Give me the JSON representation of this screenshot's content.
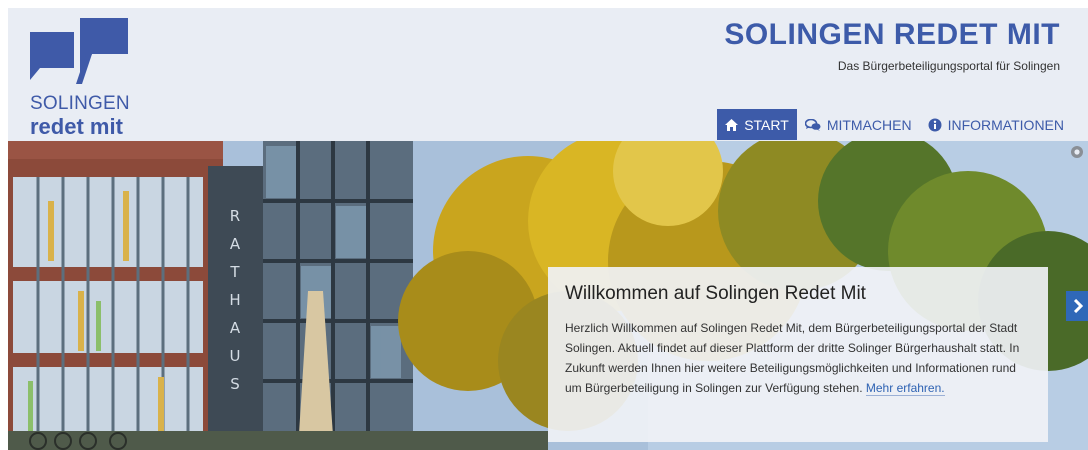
{
  "header": {
    "logo_line1": "SOLINGEN",
    "logo_line2": "redet mit",
    "title": "SOLINGEN REDET MIT",
    "subtitle": "Das Bürgerbeteiligungsportal für Solingen"
  },
  "nav": {
    "items": [
      {
        "label": "START",
        "icon": "home-icon",
        "active": true
      },
      {
        "label": "MITMACHEN",
        "icon": "chat-icon",
        "active": false
      },
      {
        "label": "INFORMATIONEN",
        "icon": "info-icon",
        "active": false
      }
    ]
  },
  "hero": {
    "building_sign": "RATHAUS",
    "welcome_title": "Willkommen auf Solingen Redet Mit",
    "welcome_text": "Herzlich Willkommen auf Solingen Redet Mit, dem Bürgerbeteiligungsportal der Stadt Solingen. Aktuell findet auf dieser Plattform der dritte Solinger Bürgerhaushalt statt. In Zukunft werden Ihnen hier weitere Beteiligungsmöglichkeiten und Informationen rund um Bürgerbeteiligung in Solingen zur Verfügung stehen.",
    "more_link": "Mehr erfahren."
  },
  "colors": {
    "brand_blue": "#3d5ba9",
    "header_bg": "#e9edf4",
    "nav_active_bg": "#3d5ba9",
    "arrow_bg": "#2f68b8"
  }
}
